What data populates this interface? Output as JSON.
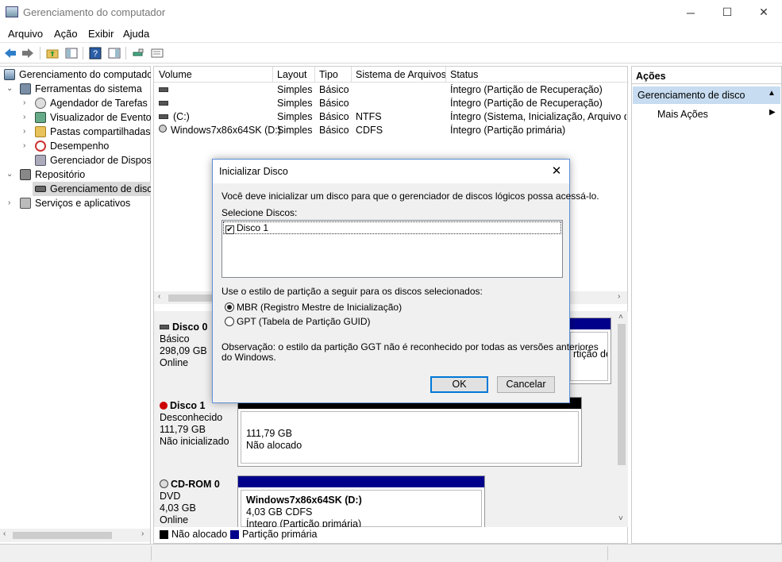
{
  "window": {
    "title": "Gerenciamento do computador",
    "controls": [
      "─",
      "☐",
      "✕"
    ]
  },
  "menu": [
    "Arquivo",
    "Ação",
    "Exibir",
    "Ajuda"
  ],
  "tree": {
    "root": "Gerenciamento do computador",
    "system_tools": "Ferramentas do sistema",
    "task_scheduler": "Agendador de Tarefas",
    "event_viewer": "Visualizador de Eventos",
    "shared_folders": "Pastas compartilhadas",
    "performance": "Desempenho",
    "device_manager": "Gerenciador de Dispositivos",
    "storage": "Repositório",
    "disk_management": "Gerenciamento de disco",
    "services": "Serviços e aplicativos"
  },
  "volumes": {
    "columns": [
      "Volume",
      "Layout",
      "Tipo",
      "Sistema de Arquivos",
      "Status"
    ],
    "rows": [
      {
        "volume": "",
        "layout": "Simples",
        "type": "Básico",
        "fs": "",
        "status": "Íntegro (Partição de Recuperação)"
      },
      {
        "volume": "",
        "layout": "Simples",
        "type": "Básico",
        "fs": "",
        "status": "Íntegro (Partição de Recuperação)"
      },
      {
        "volume": "(C:)",
        "layout": "Simples",
        "type": "Básico",
        "fs": "NTFS",
        "status": "Íntegro (Sistema, Inicialização, Arquivo de"
      },
      {
        "volume": "Windows7x86x64SK (D:)",
        "layout": "Simples",
        "type": "Básico",
        "fs": "CDFS",
        "status": "Íntegro (Partição primária)"
      }
    ]
  },
  "disks": {
    "disk0": {
      "name": "Disco 0",
      "type": "Básico",
      "size": "298,09 GB",
      "state": "Online",
      "partition_text": "rtição de"
    },
    "disk1": {
      "name": "Disco 1",
      "type": "Desconhecido",
      "size": "111,79 GB",
      "state": "Não inicializado",
      "partition_size": "111,79 GB",
      "partition_state": "Não alocado"
    },
    "cdrom0": {
      "name": "CD-ROM 0",
      "type": "DVD",
      "size": "4,03 GB",
      "state": "Online",
      "partition_name": "Windows7x86x64SK  (D:)",
      "partition_size": "4,03 GB CDFS",
      "partition_state": "Íntegro (Partição primária)"
    }
  },
  "legend": {
    "unallocated": "Não alocado",
    "primary": "Partição primária"
  },
  "actions": {
    "title": "Ações",
    "section": "Gerenciamento de disco",
    "more": "Mais Ações"
  },
  "dialog": {
    "title": "Inicializar Disco",
    "intro": "Você deve inicializar um disco para que o gerenciador de discos lógicos possa acessá-lo.",
    "select_label": "Selecione Discos:",
    "disk_item": "Disco 1",
    "style_label": "Use o estilo de partição a seguir para os discos selecionados:",
    "mbr": "MBR (Registro Mestre de Inicialização)",
    "gpt": "GPT (Tabela de Partição GUID)",
    "note": "Observação: o estilo da partição GGT não é reconhecido por todas as versões anteriores",
    "note2": "do Windows.",
    "ok": "OK",
    "cancel": "Cancelar"
  },
  "colors": {
    "primary_partition": "#00008b",
    "unallocated": "#000000",
    "accent": "#0078d7"
  }
}
